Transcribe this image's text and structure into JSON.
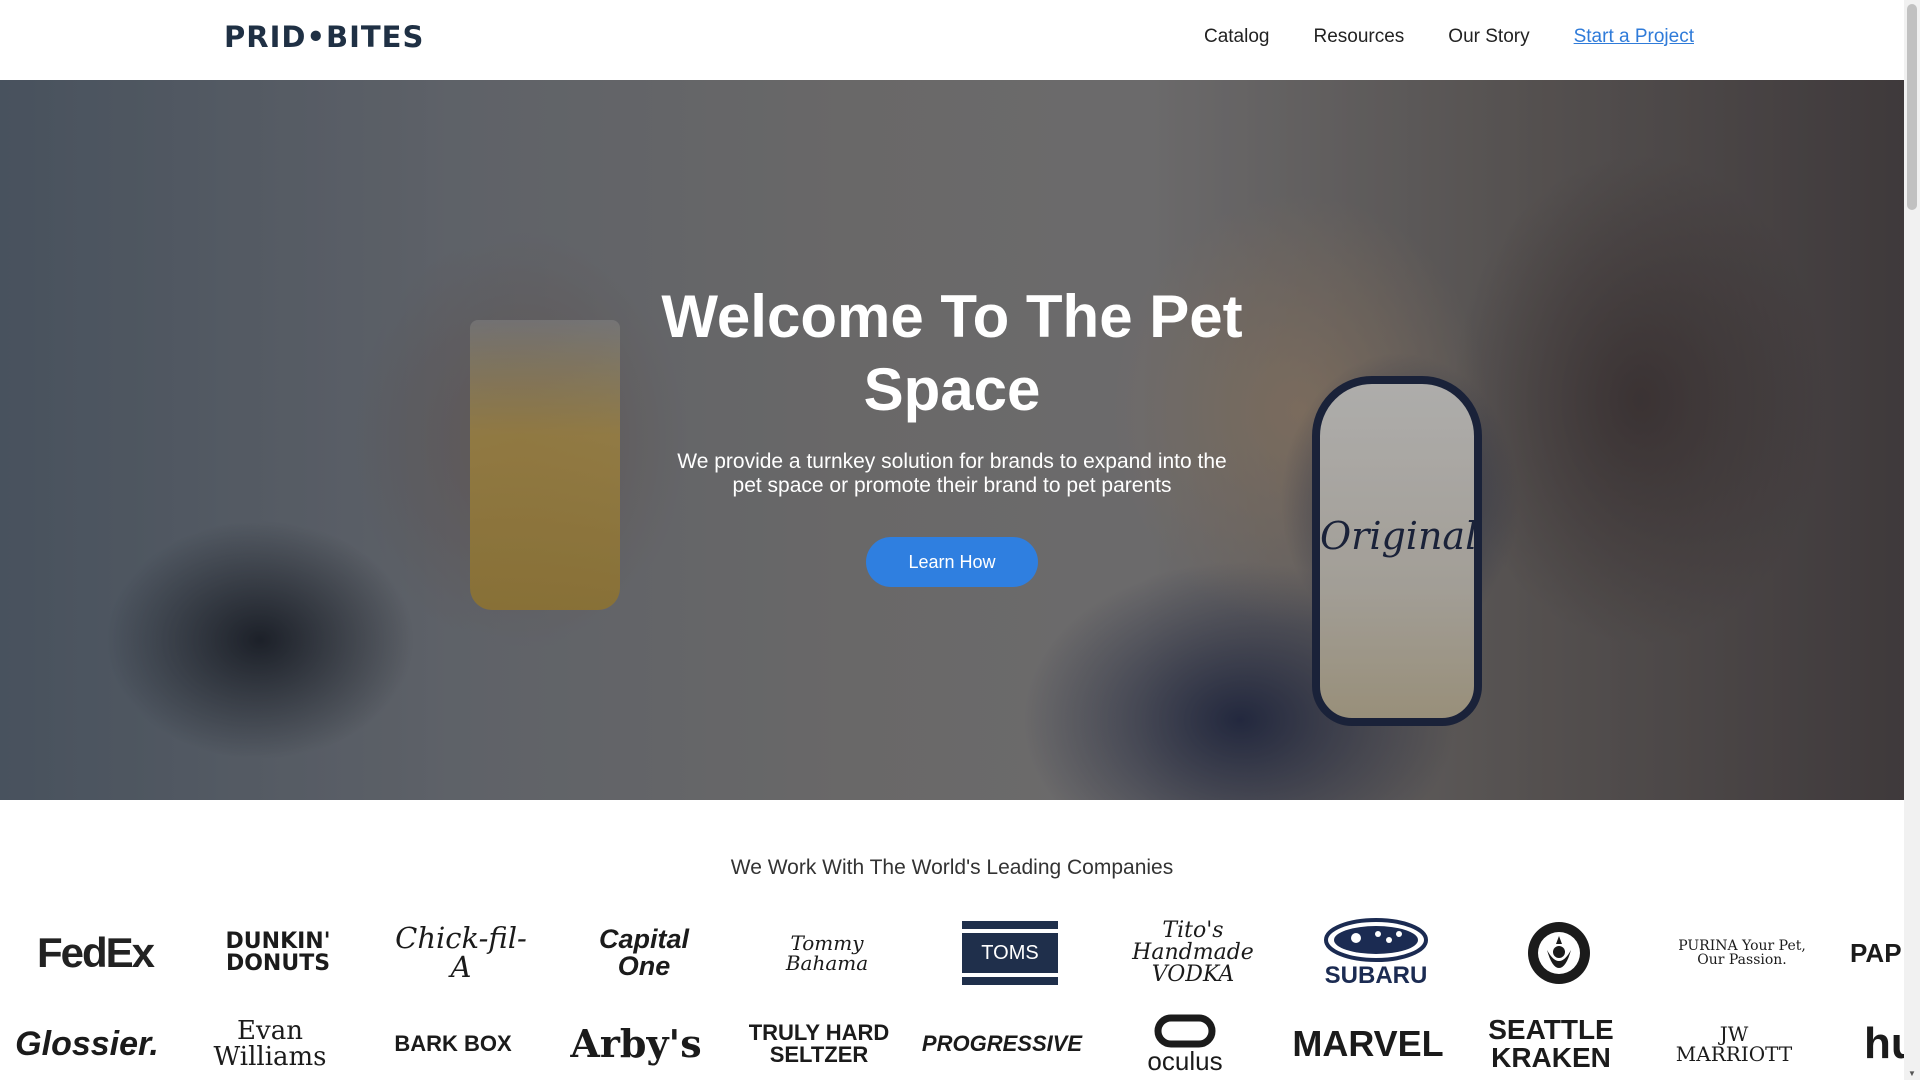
{
  "header": {
    "logo": "PRID•BITES",
    "nav": [
      "Catalog",
      "Resources",
      "Our Story",
      "Start a Project"
    ]
  },
  "hero": {
    "title": "Welcome To The Pet Space",
    "subtitle": "We provide a turnkey solution for brands to expand into the pet space or promote their brand to pet parents",
    "button": "Learn How",
    "can_text": "Original"
  },
  "brands": {
    "heading": "We Work With The World's Leading Companies",
    "row1": [
      "FedEx",
      "DUNKIN' DONUTS",
      "Chick-fil-A",
      "Capital One",
      "Tommy Bahama",
      "TOMS",
      "Tito's Handmade VODKA",
      "SUBARU",
      "",
      "PURINA Your Pet, Our Passion.",
      "PAP"
    ],
    "row2": [
      "Glossier.",
      "Evan Williams",
      "BARK BOX",
      "Arby's",
      "TRULY HARD SELTZER",
      "PROGRESSIVE",
      "oculus",
      "MARVEL",
      "SEATTLE KRAKEN",
      "JW MARRIOTT",
      "hu"
    ]
  }
}
